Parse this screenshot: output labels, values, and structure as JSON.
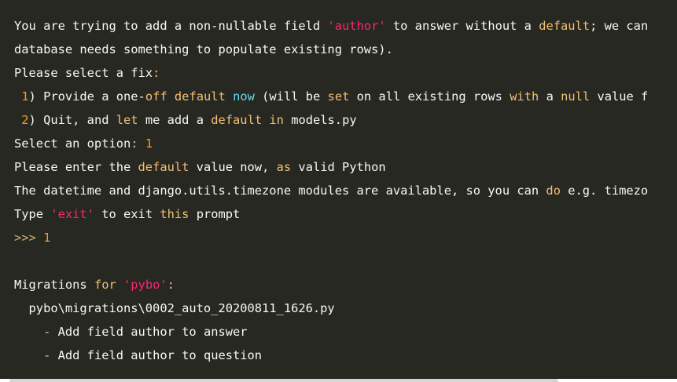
{
  "terminal": {
    "lines": [
      {
        "segments": [
          {
            "text": "You are trying to add a non-",
            "color": "#f8f8f2"
          },
          {
            "text": "nullable",
            "color": "#f8f8f2"
          },
          {
            "text": " field ",
            "color": "#f8f8f2"
          },
          {
            "text": "'author'",
            "color": "#f92672"
          },
          {
            "text": " to answer without a ",
            "color": "#f8f8f2"
          },
          {
            "text": "default",
            "color": "#f4bf75"
          },
          {
            "text": "; we can",
            "color": "#f8f8f2"
          }
        ]
      },
      {
        "segments": [
          {
            "text": "database needs something to populate existing rows).",
            "color": "#f8f8f2"
          }
        ]
      },
      {
        "segments": [
          {
            "text": "Please select a fix",
            "color": "#f8f8f2"
          },
          {
            "text": ":",
            "color": "#f4bf75"
          }
        ]
      },
      {
        "segments": [
          {
            "text": " 1",
            "color": "#fd971f"
          },
          {
            "text": ") Provide a one-",
            "color": "#f8f8f2"
          },
          {
            "text": "off",
            "color": "#f4bf75"
          },
          {
            "text": " ",
            "color": "#f8f8f2"
          },
          {
            "text": "default",
            "color": "#f4bf75"
          },
          {
            "text": " ",
            "color": "#f8f8f2"
          },
          {
            "text": "now",
            "color": "#66d9ef"
          },
          {
            "text": " (will be ",
            "color": "#f8f8f2"
          },
          {
            "text": "set",
            "color": "#f4bf75"
          },
          {
            "text": " on all existing rows ",
            "color": "#f8f8f2"
          },
          {
            "text": "with",
            "color": "#f4bf75"
          },
          {
            "text": " a ",
            "color": "#f8f8f2"
          },
          {
            "text": "null",
            "color": "#f4bf75"
          },
          {
            "text": " value f",
            "color": "#f8f8f2"
          }
        ]
      },
      {
        "segments": [
          {
            "text": " 2",
            "color": "#fd971f"
          },
          {
            "text": ") Quit, and ",
            "color": "#f8f8f2"
          },
          {
            "text": "let",
            "color": "#f4bf75"
          },
          {
            "text": " me add a ",
            "color": "#f8f8f2"
          },
          {
            "text": "default",
            "color": "#f4bf75"
          },
          {
            "text": " ",
            "color": "#f8f8f2"
          },
          {
            "text": "in",
            "color": "#f4bf75"
          },
          {
            "text": " models.py",
            "color": "#f8f8f2"
          }
        ]
      },
      {
        "segments": [
          {
            "text": "Select an option",
            "color": "#f8f8f2"
          },
          {
            "text": ": ",
            "color": "#f4bf75"
          },
          {
            "text": "1",
            "color": "#fd971f"
          }
        ]
      },
      {
        "segments": [
          {
            "text": "Please enter the ",
            "color": "#f8f8f2"
          },
          {
            "text": "default",
            "color": "#f4bf75"
          },
          {
            "text": " value now, ",
            "color": "#f8f8f2"
          },
          {
            "text": "as",
            "color": "#f4bf75"
          },
          {
            "text": " valid Python",
            "color": "#f8f8f2"
          }
        ]
      },
      {
        "segments": [
          {
            "text": "The datetime and django.utils.timezone modules are available, so you can ",
            "color": "#f8f8f2"
          },
          {
            "text": "do",
            "color": "#f4bf75"
          },
          {
            "text": " e.g. timezo",
            "color": "#f8f8f2"
          }
        ]
      },
      {
        "segments": [
          {
            "text": "Type ",
            "color": "#f8f8f2"
          },
          {
            "text": "'exit'",
            "color": "#f92672"
          },
          {
            "text": " to exit ",
            "color": "#f8f8f2"
          },
          {
            "text": "this",
            "color": "#f4bf75"
          },
          {
            "text": " prompt",
            "color": "#f8f8f2"
          }
        ]
      },
      {
        "segments": [
          {
            "text": ">>>",
            "color": "#c5b36a"
          },
          {
            "text": " ",
            "color": "#f8f8f2"
          },
          {
            "text": "1",
            "color": "#fd971f"
          }
        ]
      },
      {
        "segments": []
      },
      {
        "segments": [
          {
            "text": "Migrations ",
            "color": "#f8f8f2"
          },
          {
            "text": "for",
            "color": "#f4bf75"
          },
          {
            "text": " ",
            "color": "#f8f8f2"
          },
          {
            "text": "'pybo'",
            "color": "#f92672"
          },
          {
            "text": ":",
            "color": "#f4bf75"
          }
        ]
      },
      {
        "segments": [
          {
            "text": "  pybo\\migrations\\0002_auto_20200811_1626.py",
            "color": "#f8f8f2"
          }
        ]
      },
      {
        "segments": [
          {
            "text": "    ",
            "color": "#f8f8f2"
          },
          {
            "text": "-",
            "color": "#f4bf75"
          },
          {
            "text": " Add field author to answer",
            "color": "#f8f8f2"
          }
        ]
      },
      {
        "segments": [
          {
            "text": "    ",
            "color": "#f8f8f2"
          },
          {
            "text": "-",
            "color": "#f4bf75"
          },
          {
            "text": " Add field author to question",
            "color": "#f8f8f2"
          }
        ]
      }
    ]
  }
}
